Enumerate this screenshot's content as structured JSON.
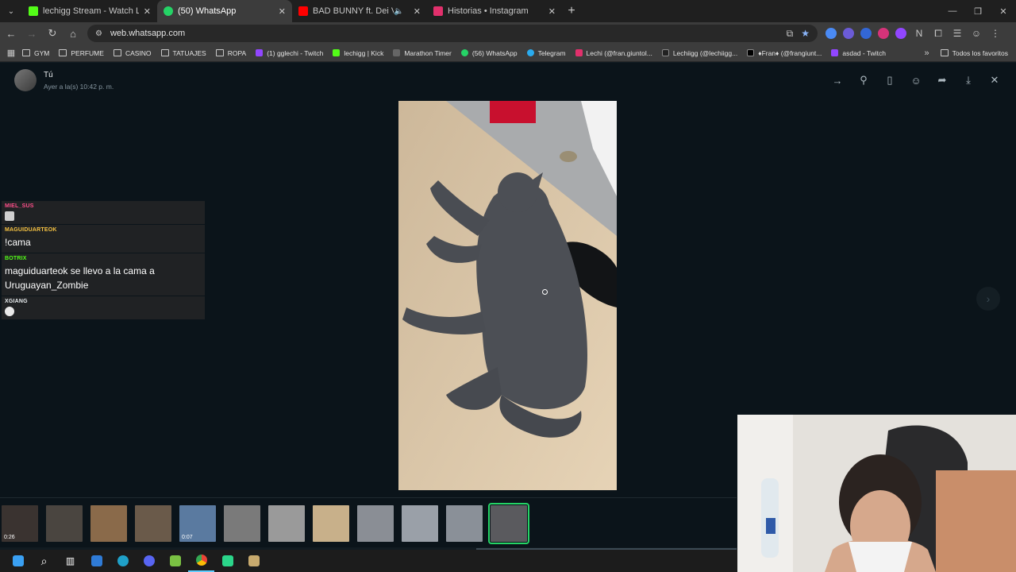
{
  "browser": {
    "tabs": [
      {
        "label": "lechigg Stream - Watch Live on",
        "favicon_color": "#53fc18",
        "active": false,
        "muted": false
      },
      {
        "label": "(50) WhatsApp",
        "favicon_color": "#25d366",
        "active": true,
        "muted": false
      },
      {
        "label": "BAD BUNNY ft. Dei V, Omar",
        "favicon_color": "#ff0000",
        "active": false,
        "muted": true
      },
      {
        "label": "Historias • Instagram",
        "favicon_color": "#e1306c",
        "active": false,
        "muted": false
      }
    ],
    "url": "web.whatsapp.com",
    "bookmarks": [
      {
        "label": "GYM",
        "kind": "folder"
      },
      {
        "label": "PERFUME",
        "kind": "folder"
      },
      {
        "label": "CASINO",
        "kind": "folder"
      },
      {
        "label": "TATUAJES",
        "kind": "folder"
      },
      {
        "label": "ROPA",
        "kind": "folder"
      },
      {
        "label": "(1) gglechi - Twitch",
        "kind": "site",
        "color": "#9146ff"
      },
      {
        "label": "lechigg | Kick",
        "kind": "site",
        "color": "#53fc18"
      },
      {
        "label": "Marathon Timer",
        "kind": "site",
        "color": "#666666"
      },
      {
        "label": "(56) WhatsApp",
        "kind": "site",
        "color": "#25d366"
      },
      {
        "label": "Telegram",
        "kind": "site",
        "color": "#2aabee"
      },
      {
        "label": "Lechi (@fran.giuntol...",
        "kind": "site",
        "color": "#e1306c"
      },
      {
        "label": "Lechiigg (@lechiigg...",
        "kind": "site",
        "color": "#222222"
      },
      {
        "label": "♦Fran♦ (@frangiunt...",
        "kind": "site",
        "color": "#000000"
      },
      {
        "label": "asdad - Twitch",
        "kind": "site",
        "color": "#9146ff"
      }
    ],
    "all_bookmarks_label": "Todos los favoritos"
  },
  "viewer": {
    "sender": "Tú",
    "timestamp": "Ayer a la(s) 10:42 p. m.",
    "actions": [
      "forward-icon",
      "pin-icon",
      "bookmark-icon",
      "emoji-icon",
      "share-icon",
      "download-icon",
      "close-icon"
    ],
    "thumbnails": [
      {
        "duration": "0:26",
        "color": "#3a3330"
      },
      {
        "duration": "",
        "color": "#4a4540"
      },
      {
        "duration": "",
        "color": "#8a6a4a"
      },
      {
        "duration": "",
        "color": "#6a5a4a"
      },
      {
        "duration": "0:07",
        "color": "#5a7aa0"
      },
      {
        "duration": "",
        "color": "#7a7a7a"
      },
      {
        "duration": "",
        "color": "#9a9a9a"
      },
      {
        "duration": "",
        "color": "#c8b08a"
      },
      {
        "duration": "",
        "color": "#8a8e95"
      },
      {
        "duration": "",
        "color": "#9aa0a8"
      },
      {
        "duration": "",
        "color": "#8a9098"
      },
      {
        "duration": "",
        "color": "#5a5a5e",
        "selected": true
      }
    ]
  },
  "chat": [
    {
      "user": "MIEL_SUS",
      "user_color": "#ff4f8b",
      "text": "",
      "emote": true
    },
    {
      "user": "MAGUIDUARTEOK",
      "user_color": "#f5c242",
      "text": "!cama",
      "emote": false
    },
    {
      "user": "BOTRIX",
      "user_color": "#53fc18",
      "text": "maguiduarteok se llevo a la cama a Uruguayan_Zombie",
      "emote": false
    },
    {
      "user": "XGIANG",
      "user_color": "#e9edef",
      "text": "",
      "emote": true
    }
  ],
  "taskbar": [
    "windows-icon",
    "search-icon",
    "task-view-icon",
    "explorer-icon",
    "edge-icon",
    "discord-icon",
    "app-icon",
    "chrome-icon",
    "kick-icon",
    "league-icon"
  ]
}
